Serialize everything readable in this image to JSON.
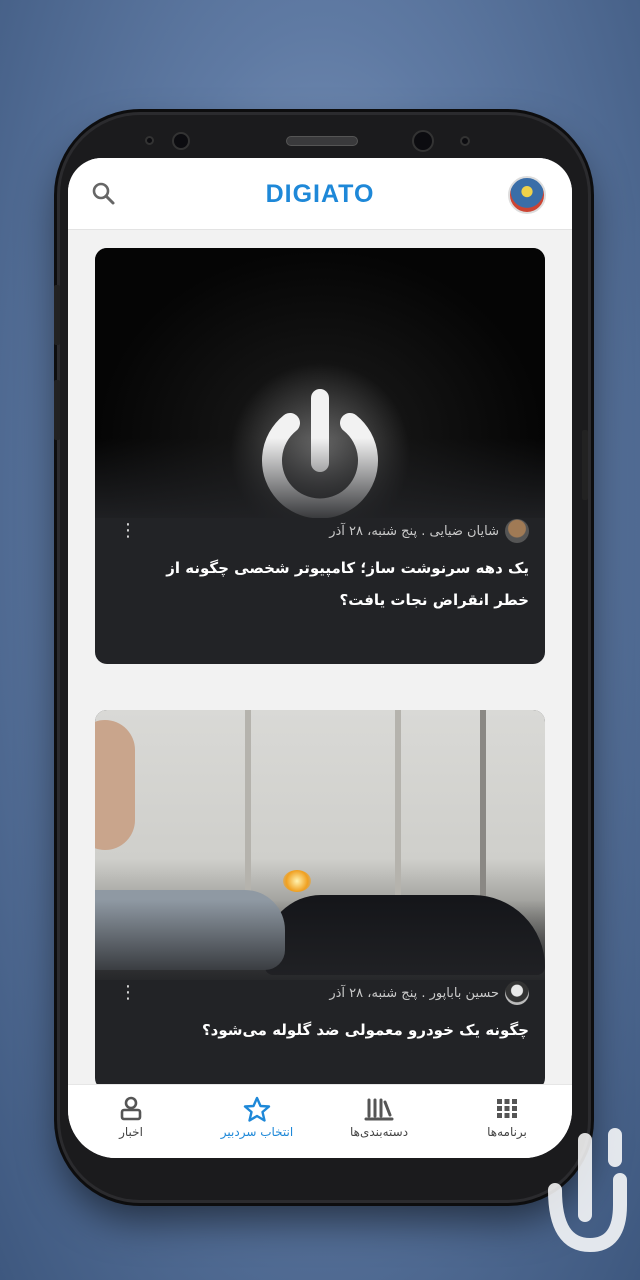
{
  "header": {
    "logo_text": "DIGIATO",
    "search_icon": "search-icon",
    "profile_icon": "avatar"
  },
  "feed": [
    {
      "author": "شایان ضیایی",
      "date": "پنج شنبه، ۲۸ آذر",
      "meta": "شایان ضیایی . پنج شنبه، ۲۸ آذر",
      "title": "یک دهه سرنوشت ساز؛ کامپیوتر شخصی چگونه از خطر انقراض نجات یافت؟",
      "image_icon": "power-icon"
    },
    {
      "author": "حسین باباپور",
      "date": "پنج شنبه، ۲۸ آذر",
      "meta": "حسین باباپور . پنج شنبه، ۲۸ آذر",
      "title": "چگونه یک خودرو معمولی ضد گلوله می‌شود؟",
      "image_icon": "shooting-photo"
    }
  ],
  "bottom_nav": {
    "items": [
      {
        "label": "برنامه‌ها",
        "icon": "grid-icon",
        "active": false
      },
      {
        "label": "دسته‌بندی‌ها",
        "icon": "bars-icon",
        "active": false
      },
      {
        "label": "انتخاب سردبیر",
        "icon": "star-icon",
        "active": true
      },
      {
        "label": "اخبار",
        "icon": "person-icon",
        "active": false
      }
    ]
  },
  "colors": {
    "accent": "#1e88d8",
    "card_bg": "#222326",
    "screen_bg": "#f2f2f2"
  }
}
